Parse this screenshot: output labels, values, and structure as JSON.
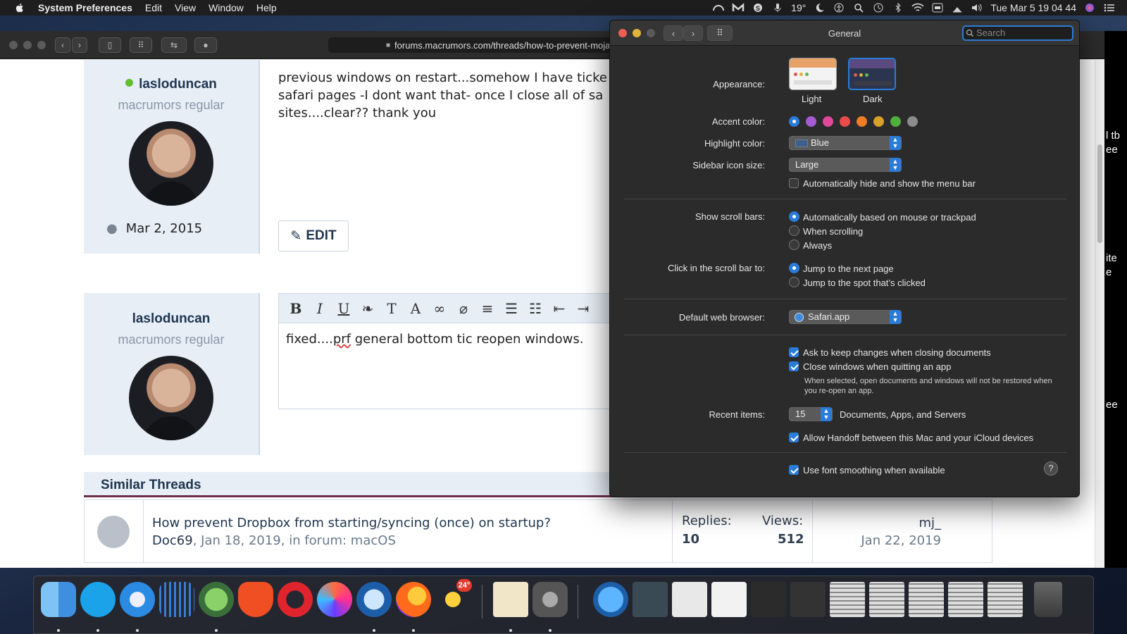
{
  "menubar": {
    "app_name": "System Preferences",
    "menus": [
      "Edit",
      "View",
      "Window",
      "Help"
    ],
    "temperature": "19°",
    "clock": "Tue Mar 5  19 04 44"
  },
  "browser": {
    "url": "forums.macrumors.com/threads/how-to-prevent-moja"
  },
  "post1": {
    "username": "lasloduncan",
    "role": "macrumors regular",
    "join_date": "Mar 2, 2015",
    "text_line1": "previous windows on restart...somehow I have ticke",
    "text_line2": "safari pages -I dont want that- once I close all of sa",
    "text_line3": "sites....clear?? thank you",
    "edit_label": "EDIT"
  },
  "post2": {
    "username": "lasloduncan",
    "role": "macrumors regular",
    "reply_pre": "fixed....",
    "reply_misspelled": "prf",
    "reply_post": " general bottom tic reopen windows."
  },
  "similar": {
    "heading": "Similar Threads",
    "thread_title": "How prevent Dropbox from starting/syncing (once) on startup?",
    "thread_author": "Doc69",
    "thread_meta": ", Jan 18, 2019, in forum: macOS",
    "replies_label": "Replies:",
    "replies": "10",
    "views_label": "Views:",
    "views": "512",
    "last_user": "mj_",
    "last_date": "Jan 22, 2019"
  },
  "peek": [
    "l tb",
    "ee",
    "ite",
    "e",
    "ee"
  ],
  "prefs": {
    "title": "General",
    "search_placeholder": "Search",
    "appearance_label": "Appearance:",
    "appearance_light": "Light",
    "appearance_dark": "Dark",
    "accent_label": "Accent color:",
    "accent_colors": [
      "#2a7cd9",
      "#a55bd6",
      "#e2479b",
      "#eb4b4b",
      "#ee7d25",
      "#d9a12a",
      "#4fb13c",
      "#8c8c8c"
    ],
    "highlight_label": "Highlight color:",
    "highlight_value": "Blue",
    "sidebar_label": "Sidebar icon size:",
    "sidebar_value": "Large",
    "autohide_menu": "Automatically hide and show the menu bar",
    "scrollbars_label": "Show scroll bars:",
    "scroll_auto": "Automatically based on mouse or trackpad",
    "scroll_when": "When scrolling",
    "scroll_always": "Always",
    "click_label": "Click in the scroll bar to:",
    "click_next": "Jump to the next page",
    "click_spot": "Jump to the spot that’s clicked",
    "browser_label": "Default web browser:",
    "browser_value": "Safari.app",
    "ask_keep": "Ask to keep changes when closing documents",
    "close_windows": "Close windows when quitting an app",
    "close_note": "When selected, open documents and windows will not be restored when you re-open an app.",
    "recent_label": "Recent items:",
    "recent_value": "15",
    "recent_suffix": "Documents, Apps, and Servers",
    "handoff": "Allow Handoff between this Mac and your iCloud devices",
    "smoothing": "Use font smoothing when available",
    "help": "?"
  },
  "dock": {
    "badge": "24°"
  }
}
